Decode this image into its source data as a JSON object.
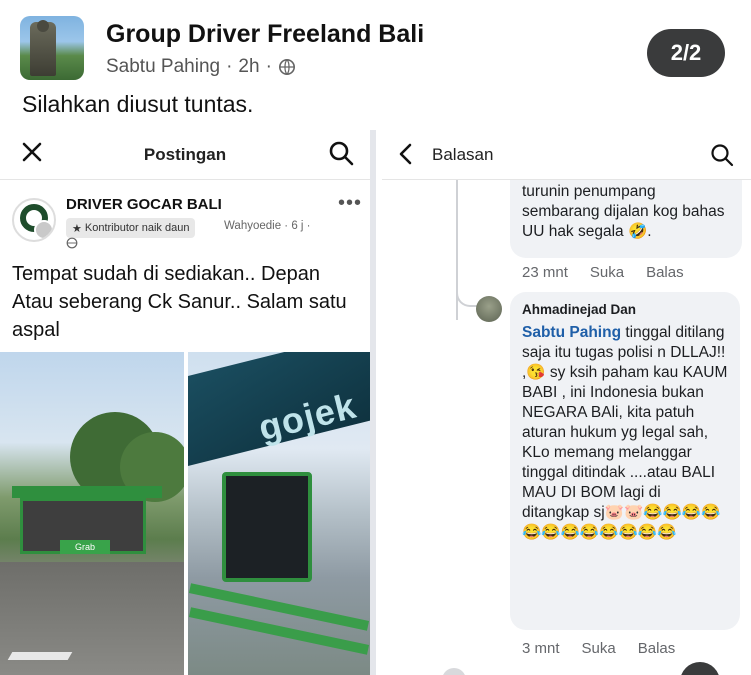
{
  "header": {
    "group_name": "Group Driver Freeland Bali",
    "author": "Sabtu Pahing",
    "time": "2h",
    "separator": "·",
    "pager": "2/2",
    "caption": "Silahkan diusut tuntas."
  },
  "left_screenshot": {
    "topbar_title": "Postingan",
    "page_name": "DRIVER GOCAR BALI",
    "badge": "Kontributor naik daun",
    "author_time": "Wahyoedie · 6 j ·",
    "post_text": "Tempat sudah di sediakan.. Depan Atau seberang Ck Sanur.. Salam satu aspal",
    "photo1_sign": "Grab",
    "photo2_brand": "gojek"
  },
  "right_screenshot": {
    "topbar_title": "Balasan",
    "reply1": {
      "text": "turunin penumpang sembarang dijalan kog bahas UU hak segala 🤣.",
      "time": "23 mnt",
      "like": "Suka",
      "reply": "Balas"
    },
    "reply2": {
      "name": "Ahmadinejad Dan",
      "mention": "Sabtu Pahing",
      "text": " tinggal ditilang saja itu tugas polisi n DLLAJ!! ,😘 sy ksih paham kau KAUM BABI , ini Indonesia bukan NEGARA BAli, kita patuh aturan hukum yg legal sah, KLo memang melanggar tinggal ditindak ....atau BALI MAU DI BOM lagi di ditangkap sj🐷🐷😂😂😂😂😂😂😂😂😂😂😂😂",
      "time": "3 mnt",
      "like": "Suka",
      "reply": "Balas"
    }
  }
}
